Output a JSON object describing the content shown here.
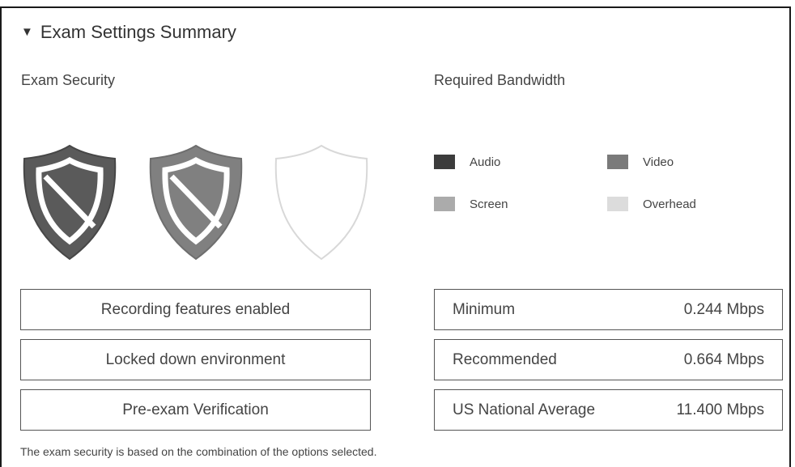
{
  "header": {
    "toggle_icon": "triangle-down-icon",
    "title": "Exam Settings Summary"
  },
  "security": {
    "title": "Exam Security",
    "shields": [
      {
        "icon": "shield-icon",
        "state": "active",
        "color": "#5a5a5a"
      },
      {
        "icon": "shield-icon",
        "state": "active",
        "color": "#808080"
      },
      {
        "icon": "shield-icon",
        "state": "inactive",
        "color": "#d8d8d8"
      }
    ],
    "features": [
      {
        "label": "Recording features enabled"
      },
      {
        "label": "Locked down environment"
      },
      {
        "label": "Pre-exam Verification"
      }
    ],
    "footnote": "The exam security is based on the combination of the options selected."
  },
  "bandwidth": {
    "title": "Required Bandwidth",
    "legend": [
      {
        "label": "Audio",
        "color": "#3c3c3c"
      },
      {
        "label": "Video",
        "color": "#7a7a7a"
      },
      {
        "label": "Screen",
        "color": "#ababab"
      },
      {
        "label": "Overhead",
        "color": "#dcdcdc"
      }
    ],
    "rows": [
      {
        "label": "Minimum",
        "value": "0.244 Mbps"
      },
      {
        "label": "Recommended",
        "value": "0.664 Mbps"
      },
      {
        "label": "US National Average",
        "value": "11.400 Mbps"
      }
    ]
  }
}
